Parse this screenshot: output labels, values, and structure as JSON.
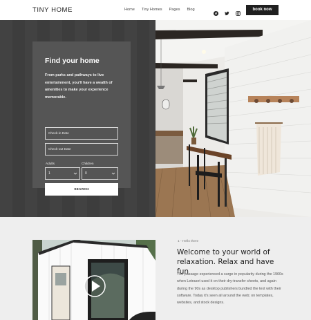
{
  "header": {
    "logo": "TINY HOME",
    "nav": [
      "Home",
      "Tiny Homes",
      "Pages",
      "Blog"
    ],
    "social_icons": [
      "facebook-icon",
      "twitter-icon",
      "instagram-icon"
    ],
    "book_button": "book now"
  },
  "search_panel": {
    "title": "Find your home",
    "description": "From parks and pathways to live entertainment, you'll have a wealth of amenities to make your experience memorable.",
    "checkin_placeholder": "Check-in Date",
    "checkout_placeholder": "Check-out Date",
    "adults_label": "Adults",
    "children_label": "Children",
    "adults_value": "1",
    "children_value": "0",
    "search_button": "SEARCH"
  },
  "intro": {
    "kicker": "1 - Hello there",
    "title": "Welcome to your world of relaxation. Relax and have fun",
    "body": "The passage experienced a surge in popularity during the 1960s when Letraset used it on their dry-transfer sheets, and again during the 90s as desktop publishers bundled the text with their software. Today it's seen all around the web; on templates, websites, and stock designs."
  },
  "colors": {
    "hero_dark": "#3f3f3f",
    "panel": "#555555",
    "button_dark": "#1f1f1f",
    "section_bg": "#eeeeee"
  }
}
